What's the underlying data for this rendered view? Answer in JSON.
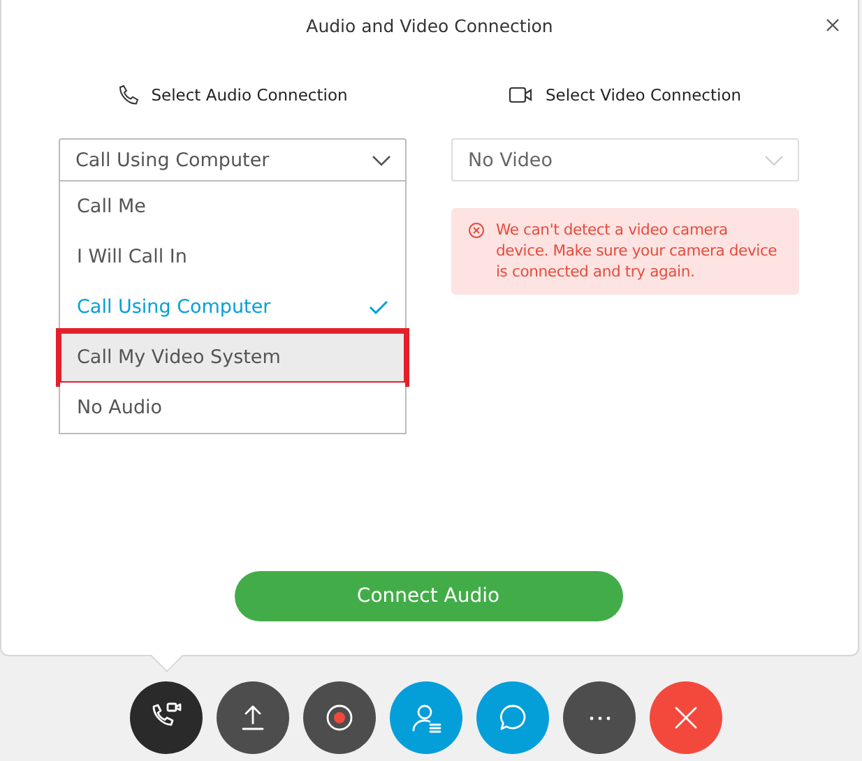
{
  "window": {
    "title": "Audio and Video Connection"
  },
  "audio": {
    "label": "Select Audio Connection",
    "value": "Call Using Computer",
    "expanded": true,
    "options": [
      {
        "label": "Call Me",
        "selected": false,
        "highlighted": false
      },
      {
        "label": "I Will Call In",
        "selected": false,
        "highlighted": false
      },
      {
        "label": "Call Using Computer",
        "selected": true,
        "highlighted": false
      },
      {
        "label": "Call My Video System",
        "selected": false,
        "highlighted": true
      },
      {
        "label": "No Audio",
        "selected": false,
        "highlighted": false
      }
    ]
  },
  "video": {
    "label": "Select Video Connection",
    "value": "No Video",
    "disabled": true,
    "error": "We can't detect a video camera device. Make sure your camera device is connected and try again."
  },
  "connect_button": "Connect Audio",
  "toolbar": [
    {
      "kind": "audio",
      "color": "#2a2a2a",
      "selected": true
    },
    {
      "kind": "share",
      "color": "#4d4d4d",
      "selected": false
    },
    {
      "kind": "record",
      "color": "#4d4d4d",
      "selected": false
    },
    {
      "kind": "participants",
      "color": "#049fd9",
      "selected": false
    },
    {
      "kind": "chat",
      "color": "#049fd9",
      "selected": false
    },
    {
      "kind": "more",
      "color": "#4d4d4d",
      "selected": false
    },
    {
      "kind": "end",
      "color": "#f3493d",
      "selected": false
    }
  ]
}
